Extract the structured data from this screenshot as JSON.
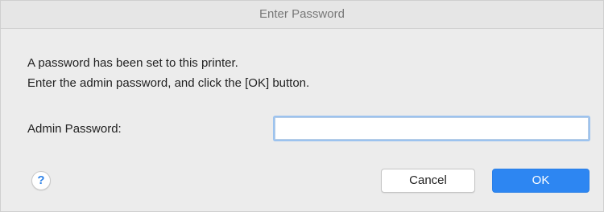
{
  "window": {
    "title": "Enter Password"
  },
  "message": {
    "line1": "A password has been set to this printer.",
    "line2": "Enter the admin password, and click the [OK] button."
  },
  "form": {
    "password_label": "Admin Password:",
    "password_value": ""
  },
  "buttons": {
    "help_glyph": "?",
    "cancel_label": "Cancel",
    "ok_label": "OK"
  },
  "icons": {
    "help": "help-icon"
  },
  "colors": {
    "accent": "#2d86f2",
    "focus_ring": "#9cc3ef",
    "window_background": "#ececec"
  }
}
